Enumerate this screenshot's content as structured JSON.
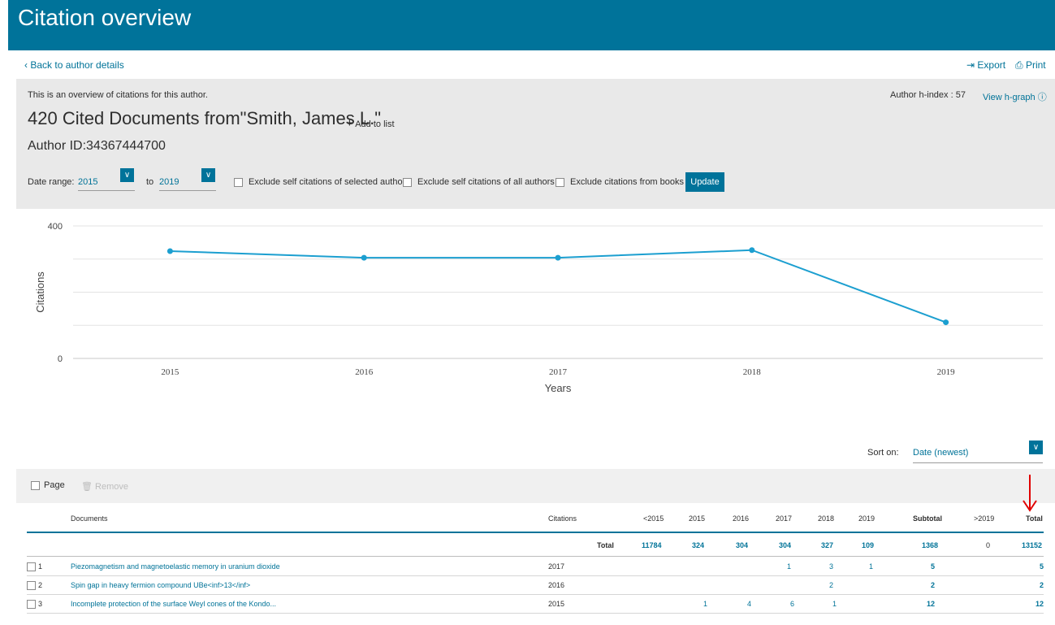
{
  "header": {
    "title": "Citation overview"
  },
  "nav": {
    "back": "Back to author details",
    "export": "Export",
    "print": "Print"
  },
  "info": {
    "intro": "This is an overview of citations for this author.",
    "hindex_label": "Author h-index : 57",
    "hgraph_link": "View h-graph",
    "heading": "420 Cited Documents from\"Smith, James L.\"",
    "add_to_list": "Add to list",
    "author_id": "Author ID:34367444700"
  },
  "filters": {
    "date_range_label": "Date range:",
    "from_year": "2015",
    "to_label": "to",
    "to_year": "2019",
    "exclude_self_selected": "Exclude self citations of selected author",
    "exclude_self_all": "Exclude self citations of all authors",
    "exclude_books": "Exclude citations from books",
    "update": "Update"
  },
  "chart_data": {
    "type": "line",
    "x": [
      "2015",
      "2016",
      "2017",
      "2018",
      "2019"
    ],
    "series": [
      {
        "values": [
          324,
          304,
          304,
          327,
          109
        ]
      }
    ],
    "xlabel": "Years",
    "ylabel": "Citations",
    "ylim": [
      0,
      400
    ],
    "yticks": [
      "0",
      "400"
    ],
    "grid": true,
    "color": "#1c9fd0"
  },
  "sort": {
    "label": "Sort on:",
    "value": "Date (newest)"
  },
  "toolbar": {
    "page": "Page",
    "remove": "Remove"
  },
  "table": {
    "columns": {
      "documents": "Documents",
      "citations": "Citations",
      "lt2015": "<2015",
      "y2015": "2015",
      "y2016": "2016",
      "y2017": "2017",
      "y2018": "2018",
      "y2019": "2019",
      "subtotal": "Subtotal",
      "gt2019": ">2019",
      "total": "Total"
    },
    "totals": {
      "label": "Total",
      "lt2015": "11784",
      "y2015": "324",
      "y2016": "304",
      "y2017": "304",
      "y2018": "327",
      "y2019": "109",
      "subtotal": "1368",
      "gt2019": "0",
      "total": "13152"
    },
    "rows": [
      {
        "num": "1",
        "title": "Piezomagnetism and magnetoelastic memory in uranium dioxide",
        "year": "2017",
        "y2017": "1",
        "y2018": "3",
        "y2019": "1",
        "subtotal": "5",
        "total": "5"
      },
      {
        "num": "2",
        "title": "Spin gap in heavy fermion compound UBe<inf>13</inf>",
        "year": "2016",
        "y2018": "2",
        "subtotal": "2",
        "total": "2"
      },
      {
        "num": "3",
        "title": "Incomplete protection of the surface Weyl cones of the Kondo...",
        "year": "2015",
        "y2015": "1",
        "y2016": "4",
        "y2017": "6",
        "y2018": "1",
        "subtotal": "12",
        "total": "12"
      }
    ]
  }
}
